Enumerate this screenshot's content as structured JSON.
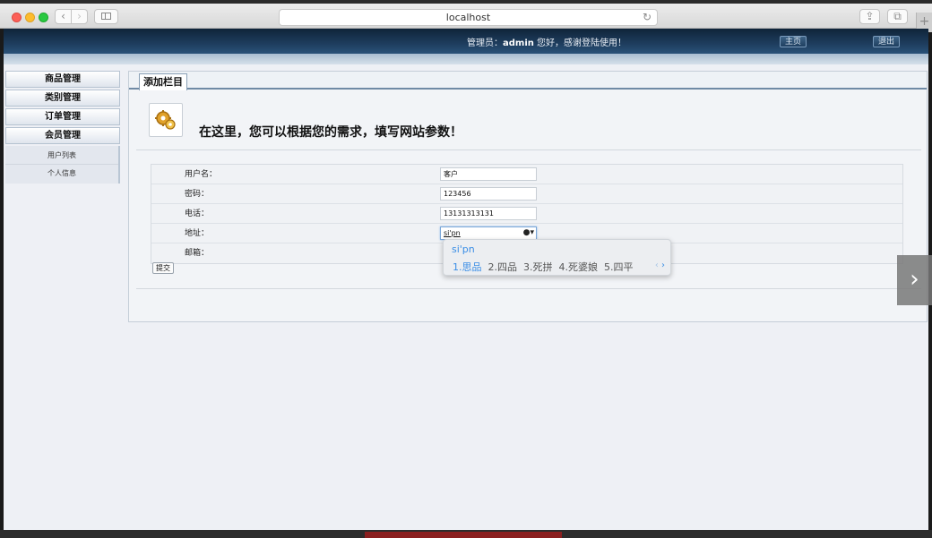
{
  "browser": {
    "url": "localhost",
    "back_glyph": "‹",
    "forward_glyph": "›",
    "reload_glyph": "↻",
    "share_glyph": "⇪",
    "tabs_glyph": "⧉",
    "newtab_glyph": "+"
  },
  "header": {
    "greeting_prefix": "管理员：",
    "username": "admin",
    "greeting_suffix": " 您好，感谢登陆使用！",
    "home_label": "主页",
    "logout_label": "退出"
  },
  "menu": {
    "items": [
      {
        "label": "商品管理"
      },
      {
        "label": "类别管理"
      },
      {
        "label": "订单管理"
      },
      {
        "label": "会员管理"
      }
    ],
    "subitems": [
      {
        "label": "用户列表"
      },
      {
        "label": "个人信息"
      }
    ]
  },
  "panel": {
    "tab_label": "添加栏目",
    "info_text": "在这里，您可以根据您的需求，填写网站参数！"
  },
  "form": {
    "fields": [
      {
        "label": "用户名：",
        "value": "客户"
      },
      {
        "label": "密码：",
        "value": "123456"
      },
      {
        "label": "电话：",
        "value": "13131313131"
      },
      {
        "label": "地址：",
        "value": "si'pn"
      },
      {
        "label": "邮箱：",
        "value": ""
      }
    ],
    "submit_label": "提交"
  },
  "ime": {
    "pinyin": "si'pn",
    "candidates": [
      "1.思品",
      "2.四品",
      "3.死拼",
      "4.死婆娘",
      "5.四平"
    ],
    "active_index": 0,
    "prev_glyph": "‹",
    "next_glyph": "›"
  },
  "overlay": {
    "next_glyph": "›"
  },
  "colors": {
    "header_bg": "#1e3d5e",
    "ime_accent": "#3a8ee6"
  }
}
